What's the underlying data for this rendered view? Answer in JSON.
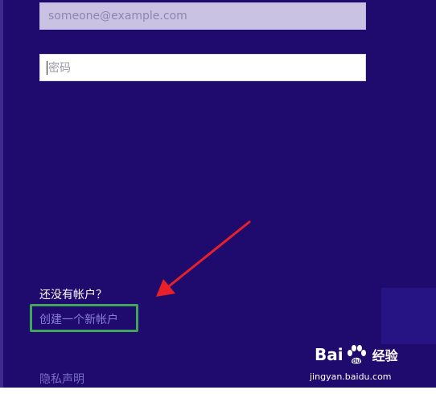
{
  "login": {
    "email_placeholder": "someone@example.com",
    "password_placeholder": "密码"
  },
  "signup": {
    "prompt": "还没有帐户？",
    "create_link": "创建一个新帐户"
  },
  "footer": {
    "privacy_link": "隐私声明"
  },
  "watermark": {
    "brand_left": "Bai",
    "brand_right": "经验",
    "icon": "baidu-paw-icon",
    "url": "jingyan.baidu.com"
  },
  "colors": {
    "background": "#1f0a6e",
    "link": "#8a7fd6",
    "highlight_box": "#3fa55a",
    "annotation_arrow": "#e8202a"
  }
}
